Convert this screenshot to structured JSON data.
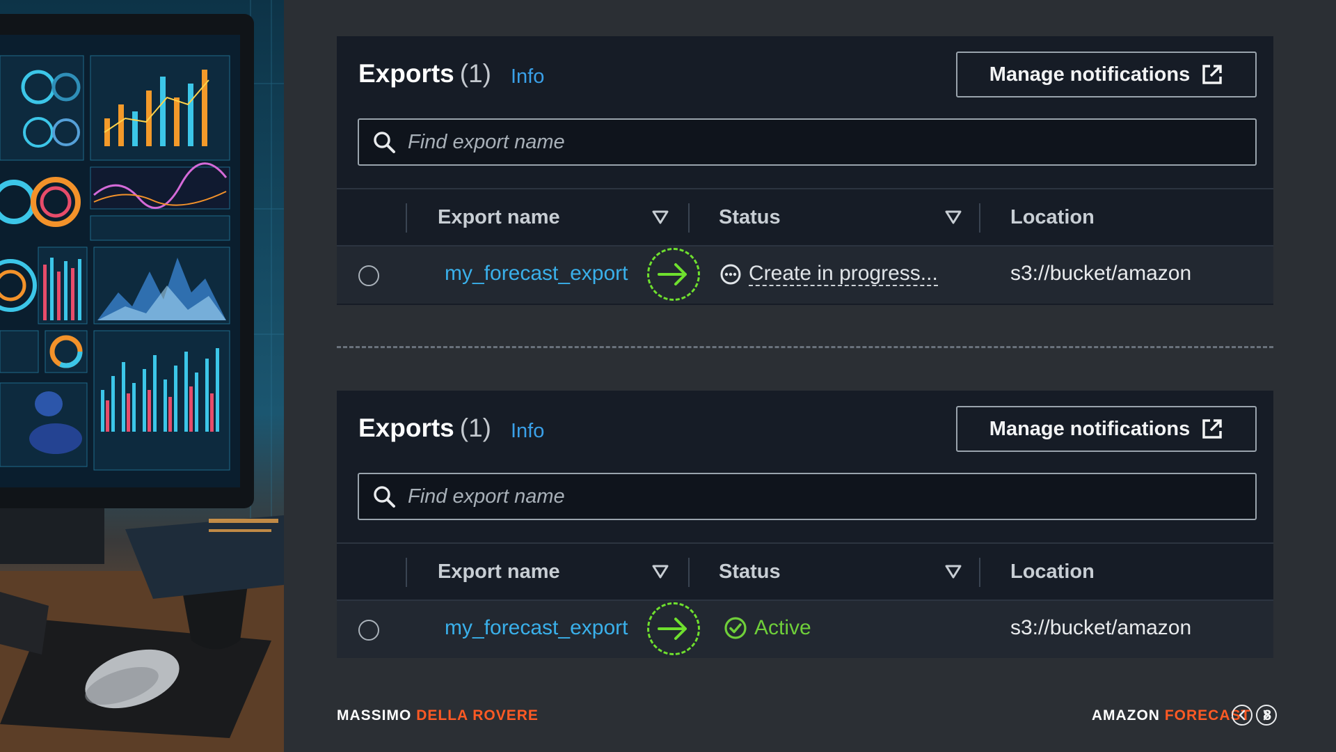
{
  "panels": [
    {
      "title": "Exports",
      "count": "(1)",
      "info": "Info",
      "notify_label": "Manage notifications",
      "search_placeholder": "Find export name",
      "columns": {
        "name": "Export name",
        "status": "Status",
        "location": "Location"
      },
      "row": {
        "name": "my_forecast_export",
        "status": "Create in progress...",
        "status_kind": "in-progress",
        "location": "s3://bucket/amazon"
      }
    },
    {
      "title": "Exports",
      "count": "(1)",
      "info": "Info",
      "notify_label": "Manage notifications",
      "search_placeholder": "Find export name",
      "columns": {
        "name": "Export name",
        "status": "Status",
        "location": "Location"
      },
      "row": {
        "name": "my_forecast_export",
        "status": "Active",
        "status_kind": "active",
        "location": "s3://bucket/amazon"
      }
    }
  ],
  "footer": {
    "author_first": "MASSIMO",
    "author_last": "DELLA ROVERE",
    "product_first": "AMAZON",
    "product_last": "FORECAST",
    "page": "8"
  },
  "colors": {
    "accent_orange": "#ff5a24",
    "link_blue": "#3ab0ea",
    "success_green": "#6fcf3a",
    "arrow_green": "#6fe02e"
  }
}
